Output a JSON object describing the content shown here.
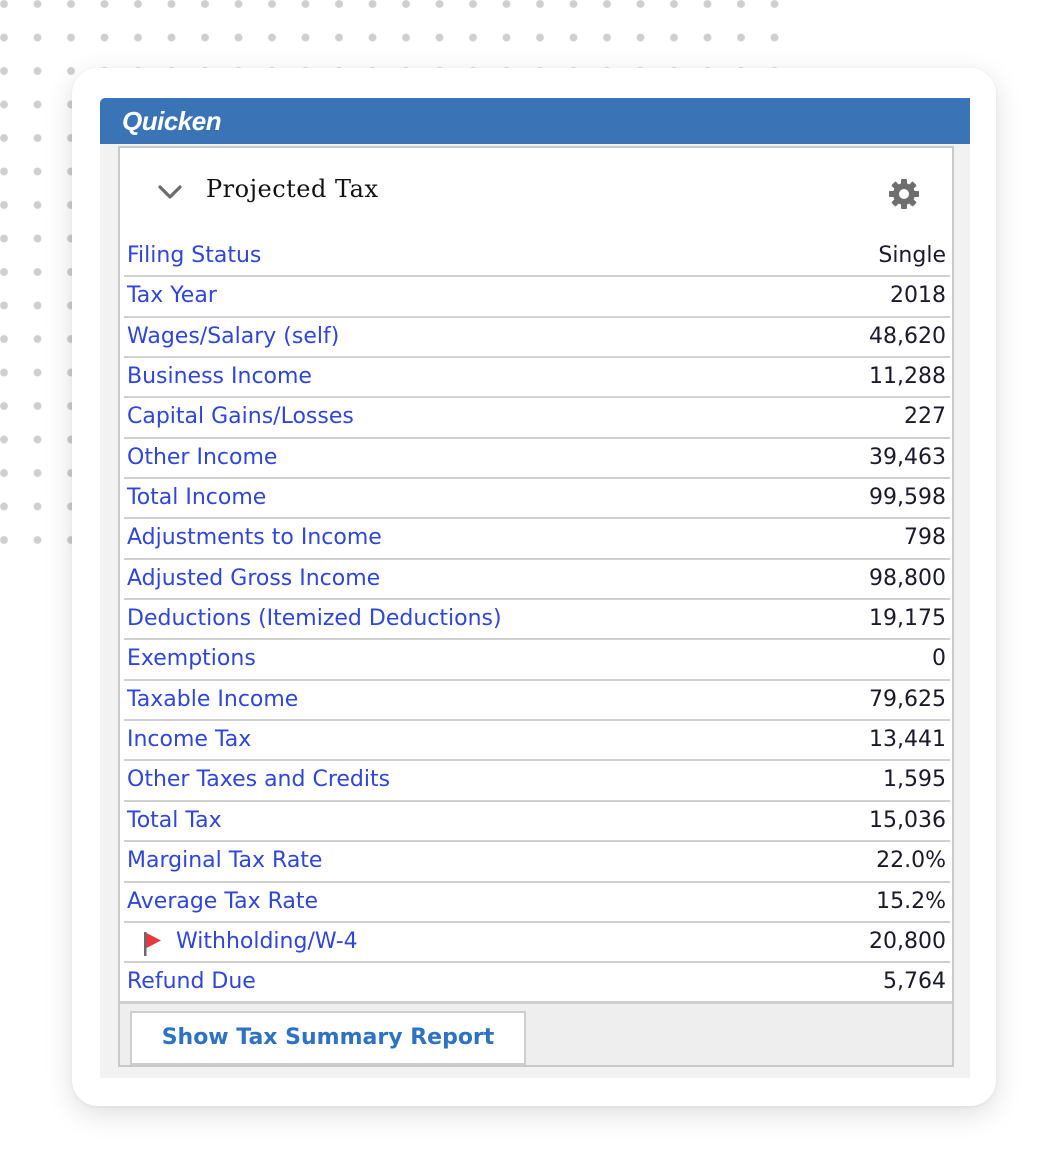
{
  "app": {
    "title": "Quicken"
  },
  "panel": {
    "title": "Projected Tax",
    "collapse_icon": "chevron-down-icon",
    "settings_icon": "gear-icon"
  },
  "rows": [
    {
      "label": "Filing Status",
      "value": "Single"
    },
    {
      "label": "Tax Year",
      "value": "2018"
    },
    {
      "label": "Wages/Salary (self)",
      "value": "48,620"
    },
    {
      "label": "Business Income",
      "value": "11,288"
    },
    {
      "label": "Capital Gains/Losses",
      "value": "227"
    },
    {
      "label": "Other Income",
      "value": "39,463"
    },
    {
      "label": "Total Income",
      "value": "99,598"
    },
    {
      "label": "Adjustments to Income",
      "value": "798"
    },
    {
      "label": "Adjusted Gross Income",
      "value": "98,800"
    },
    {
      "label": "Deductions (Itemized Deductions)",
      "value": "19,175"
    },
    {
      "label": "Exemptions",
      "value": "0"
    },
    {
      "label": "Taxable Income",
      "value": "79,625"
    },
    {
      "label": "Income Tax",
      "value": "13,441"
    },
    {
      "label": "Other Taxes and Credits",
      "value": "1,595"
    },
    {
      "label": "Total Tax",
      "value": "15,036"
    },
    {
      "label": "Marginal Tax Rate",
      "value": "22.0%"
    },
    {
      "label": "Average Tax Rate",
      "value": "15.2%"
    },
    {
      "label": "Withholding/W-4",
      "value": "20,800",
      "flag_icon": "red-flag-icon"
    },
    {
      "label": "Refund Due",
      "value": "5,764"
    }
  ],
  "footer": {
    "report_button_label": "Show Tax Summary Report"
  },
  "colors": {
    "title_bar": "#3a74b7",
    "link_label": "#2f46d8",
    "button_text": "#2d72c4",
    "flag": "#e8373e"
  }
}
